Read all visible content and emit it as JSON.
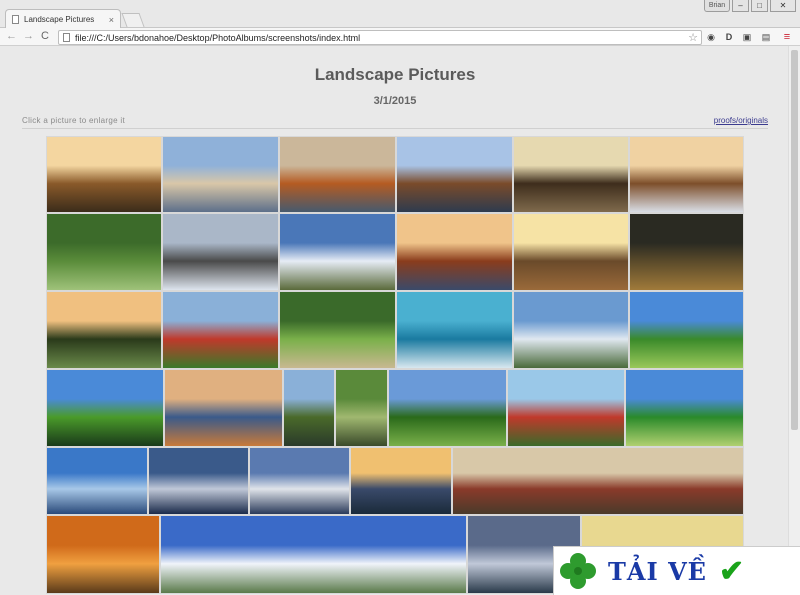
{
  "window": {
    "tab_title": "Landscape Pictures",
    "tab_close": "×",
    "user_button": "Brian",
    "minimize": "–",
    "maximize": "□",
    "close": "✕"
  },
  "toolbar": {
    "back_icon": "←",
    "forward_icon": "→",
    "reload_icon": "C",
    "url": "file:///C:/Users/bdonahoe/Desktop/PhotoAlbums/screenshots/index.html",
    "star_icon": "☆",
    "ext_icons": [
      "◉",
      "D",
      "▣",
      "▤"
    ],
    "menu_icon": "≡"
  },
  "page": {
    "title": "Landscape Pictures",
    "date": "3/1/2015",
    "hint": "Click a picture to enlarge it",
    "proofs_link": "proofs/originals"
  },
  "gallery": {
    "photos": [
      {
        "name": "sunset-tree-lake",
        "colors": [
          "#f4d6a0",
          "#8a5a2a",
          "#3b2c1a"
        ]
      },
      {
        "name": "calm-lake-sunrise",
        "colors": [
          "#8fb1d9",
          "#d9c7a8",
          "#5d6f8a"
        ]
      },
      {
        "name": "autumn-tree-shore",
        "colors": [
          "#cbb79a",
          "#b55b22",
          "#465a6e"
        ]
      },
      {
        "name": "tree-reflection",
        "colors": [
          "#a8c3e6",
          "#7a4b2a",
          "#2e3b4e"
        ]
      },
      {
        "name": "forest-sunburst",
        "colors": [
          "#e6d9b0",
          "#3e2d1c",
          "#7f6a4c"
        ]
      },
      {
        "name": "snowy-trees",
        "colors": [
          "#f0d2a2",
          "#7d4e2a",
          "#d9dde5"
        ]
      },
      {
        "name": "swans-pond",
        "colors": [
          "#3c6b2a",
          "#5a8c3a",
          "#9fc27a"
        ]
      },
      {
        "name": "snow-bridge",
        "colors": [
          "#aab7c8",
          "#4a4a4a",
          "#dde4ee"
        ]
      },
      {
        "name": "lake-clouds",
        "colors": [
          "#4a77b8",
          "#e6ecf5",
          "#5a6a3a"
        ]
      },
      {
        "name": "sunset-reeds",
        "colors": [
          "#f0c48a",
          "#8a3c1c",
          "#3a4a6a"
        ]
      },
      {
        "name": "sunburst-lake",
        "colors": [
          "#f6e3a5",
          "#6a4a2a",
          "#9a6a3a"
        ]
      },
      {
        "name": "dark-forest",
        "colors": [
          "#2a2a22",
          "#5a4a2a",
          "#a07a3a"
        ]
      },
      {
        "name": "palm-sunset",
        "colors": [
          "#f0c080",
          "#2a3a1a",
          "#6a8a4a"
        ]
      },
      {
        "name": "pagoda-garden",
        "colors": [
          "#8ab0d8",
          "#c0392b",
          "#3a7a2a"
        ]
      },
      {
        "name": "bamboo-hut",
        "colors": [
          "#3a6a2a",
          "#7ab04a",
          "#c8b890"
        ]
      },
      {
        "name": "turquoise-coast",
        "colors": [
          "#4ab0d0",
          "#1a7aa0",
          "#d8e8f0"
        ]
      },
      {
        "name": "city-coast",
        "colors": [
          "#6a9ad0",
          "#e0e8f0",
          "#4a6a3a"
        ]
      },
      {
        "name": "tropical-garden",
        "colors": [
          "#4a8ad8",
          "#3a8a2a",
          "#9ac85a"
        ]
      },
      {
        "name": "palm-valley",
        "colors": [
          "#4a8ad8",
          "#4a9a2a",
          "#1a3a1a"
        ]
      },
      {
        "name": "beach-umbrella-sunset",
        "colors": [
          "#e0b080",
          "#3a5a8a",
          "#c87a3a"
        ]
      },
      {
        "name": "palm-cliff",
        "colors": [
          "#8ab0d8",
          "#4a6a2a",
          "#2a3a2a"
        ]
      },
      {
        "name": "mossy-path",
        "colors": [
          "#5a8a3a",
          "#a0b870",
          "#3a4a2a"
        ]
      },
      {
        "name": "jungle-ridge",
        "colors": [
          "#6a9ad8",
          "#2a6a1a",
          "#7ab04a"
        ]
      },
      {
        "name": "red-flower-garden",
        "colors": [
          "#9ac8e8",
          "#c0392b",
          "#3a6a2a"
        ]
      },
      {
        "name": "palm-grove",
        "colors": [
          "#4a8ad8",
          "#2a8a2a",
          "#b0d070"
        ]
      },
      {
        "name": "ocean-coast",
        "colors": [
          "#3a78c8",
          "#a8c8e8",
          "#2a4a7a"
        ]
      },
      {
        "name": "cloudy-lake",
        "colors": [
          "#3a5a8a",
          "#c0c8d8",
          "#1a2a4a"
        ]
      },
      {
        "name": "storm-reflection",
        "colors": [
          "#5a7ab0",
          "#e0e4ea",
          "#2a3a5a"
        ]
      },
      {
        "name": "sunset-marsh",
        "colors": [
          "#f0c070",
          "#3a4a6a",
          "#1a2a3a"
        ]
      },
      {
        "name": "hotel-lobby",
        "colors": [
          "#d8c8a8",
          "#8a3a2a",
          "#4a3a2a"
        ]
      },
      {
        "name": "autumn-woods",
        "colors": [
          "#d06a1a",
          "#f0a040",
          "#5a3a1a"
        ]
      },
      {
        "name": "coastal-panorama",
        "colors": [
          "#3a6ac8",
          "#f0f4fa",
          "#5a7a4a"
        ]
      },
      {
        "name": "dusk-lake",
        "colors": [
          "#5a6a8a",
          "#c0c8d8",
          "#2a3a4a"
        ]
      },
      {
        "name": "sunlit-forest",
        "colors": [
          "#e8d890",
          "#5a8a2a",
          "#2a4a1a"
        ]
      }
    ]
  },
  "watermark": {
    "brand": "TẢI VỀ",
    "check": "✔"
  }
}
